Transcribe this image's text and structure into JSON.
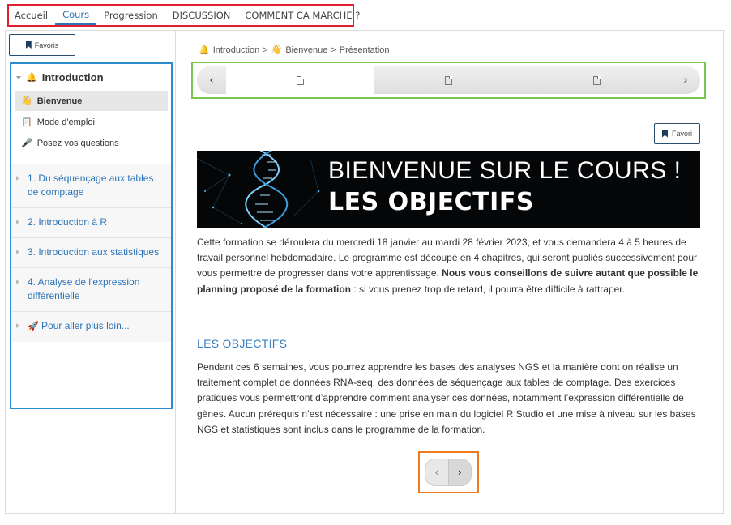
{
  "topnav": {
    "tabs": [
      "Accueil",
      "Cours",
      "Progression",
      "DISCUSSION",
      "COMMENT CA MARCHE ?"
    ],
    "active": "Cours"
  },
  "sidebar": {
    "favoris_label": "Favoris",
    "section": {
      "emoji": "🔔",
      "title": "Introduction",
      "items": [
        {
          "emoji": "👋",
          "label": "Bienvenue",
          "active": true
        },
        {
          "emoji": "📋",
          "label": "Mode d'emploi"
        },
        {
          "emoji": "🎤",
          "label": "Posez vos questions"
        }
      ]
    },
    "chapters": [
      {
        "label": "1. Du séquençage aux tables de comptage"
      },
      {
        "label": "2. Introduction à R"
      },
      {
        "label": "3. Introduction aux statistiques"
      },
      {
        "label": "4. Analyse de l'expression différentielle"
      },
      {
        "emoji": "🚀",
        "label": "Pour aller plus loin..."
      }
    ]
  },
  "breadcrumb": {
    "part1_emoji": "🔔",
    "part1": "Introduction",
    "sep": ">",
    "part2_emoji": "👋",
    "part2": "Bienvenue",
    "part3": "Présentation"
  },
  "favori_label": "Favori",
  "banner": {
    "line1": "BIENVENUE SUR LE COURS !",
    "line2": "LES OBJECTIFS"
  },
  "intro": {
    "text": "Cette formation se déroulera du mercredi 18 janvier au mardi 28 février 2023, et vous demandera 4 à 5 heures de travail personnel hebdomadaire. Le programme est découpé en 4 chapitres, qui seront publiés successivement pour vous permettre de progresser dans votre apprentissage. ",
    "bold": "Nous vous conseillons de suivre autant que possible le planning proposé de la formation",
    "tail": " : si vous prenez trop de retard, il pourra être difficile à rattraper."
  },
  "objectifs": {
    "heading": "LES OBJECTIFS",
    "text": "Pendant ces 6 semaines, vous pourrez apprendre les bases des analyses NGS et la manière dont on réalise un traitement complet de données RNA-seq, des données de séquençage aux tables de comptage. Des exercices pratiques vous permettront d’apprendre comment analyser ces données, notamment l’expression différentielle de gènes. Aucun prérequis n’est nécessaire : une prise en main du logiciel R Studio et une mise à niveau sur les bases NGS et statistiques sont inclus dans le programme de la formation."
  },
  "glyphs": {
    "prev": "‹",
    "next": "›"
  }
}
